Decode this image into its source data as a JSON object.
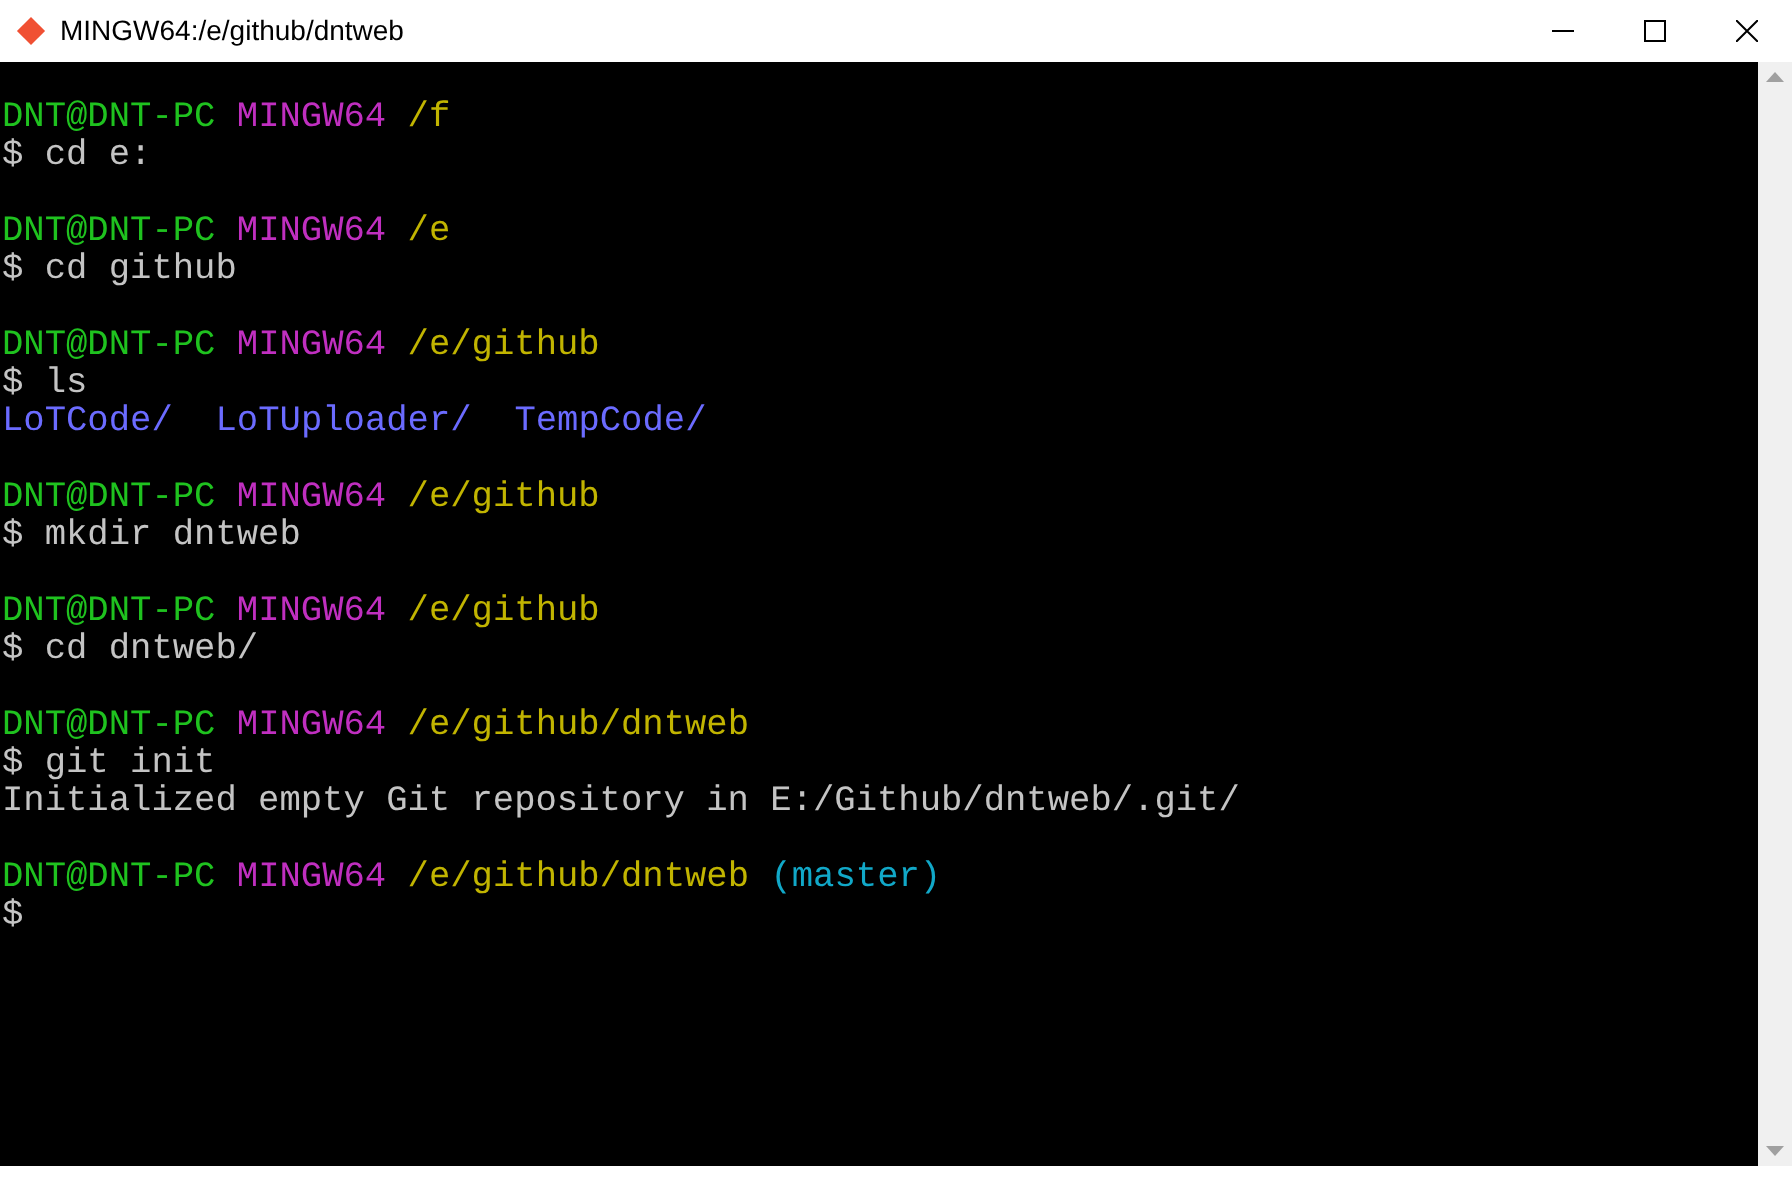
{
  "window": {
    "title": "MINGW64:/e/github/dntweb"
  },
  "lines": [
    {
      "kind": "prompt",
      "user": "DNT@DNT-PC",
      "system": "MINGW64",
      "path": "/f"
    },
    {
      "kind": "command",
      "text": "$ cd e:"
    },
    {
      "kind": "blank"
    },
    {
      "kind": "prompt",
      "user": "DNT@DNT-PC",
      "system": "MINGW64",
      "path": "/e"
    },
    {
      "kind": "command",
      "text": "$ cd github"
    },
    {
      "kind": "blank"
    },
    {
      "kind": "prompt",
      "user": "DNT@DNT-PC",
      "system": "MINGW64",
      "path": "/e/github"
    },
    {
      "kind": "command",
      "text": "$ ls"
    },
    {
      "kind": "listing",
      "items": [
        {
          "text": "LoTCode/",
          "color": "#6b6bff"
        },
        {
          "text": "LoTUploader/",
          "color": "#6b6bff"
        },
        {
          "text": "TempCode/",
          "color": "#6b6bff"
        }
      ]
    },
    {
      "kind": "blank"
    },
    {
      "kind": "prompt",
      "user": "DNT@DNT-PC",
      "system": "MINGW64",
      "path": "/e/github"
    },
    {
      "kind": "command",
      "text": "$ mkdir dntweb"
    },
    {
      "kind": "blank"
    },
    {
      "kind": "prompt",
      "user": "DNT@DNT-PC",
      "system": "MINGW64",
      "path": "/e/github"
    },
    {
      "kind": "command",
      "text": "$ cd dntweb/"
    },
    {
      "kind": "blank"
    },
    {
      "kind": "prompt",
      "user": "DNT@DNT-PC",
      "system": "MINGW64",
      "path": "/e/github/dntweb"
    },
    {
      "kind": "command",
      "text": "$ git init"
    },
    {
      "kind": "output",
      "text": "Initialized empty Git repository in E:/Github/dntweb/.git/"
    },
    {
      "kind": "blank"
    },
    {
      "kind": "prompt",
      "user": "DNT@DNT-PC",
      "system": "MINGW64",
      "path": "/e/github/dntweb",
      "branch": "(master)"
    },
    {
      "kind": "command",
      "text": "$"
    }
  ]
}
